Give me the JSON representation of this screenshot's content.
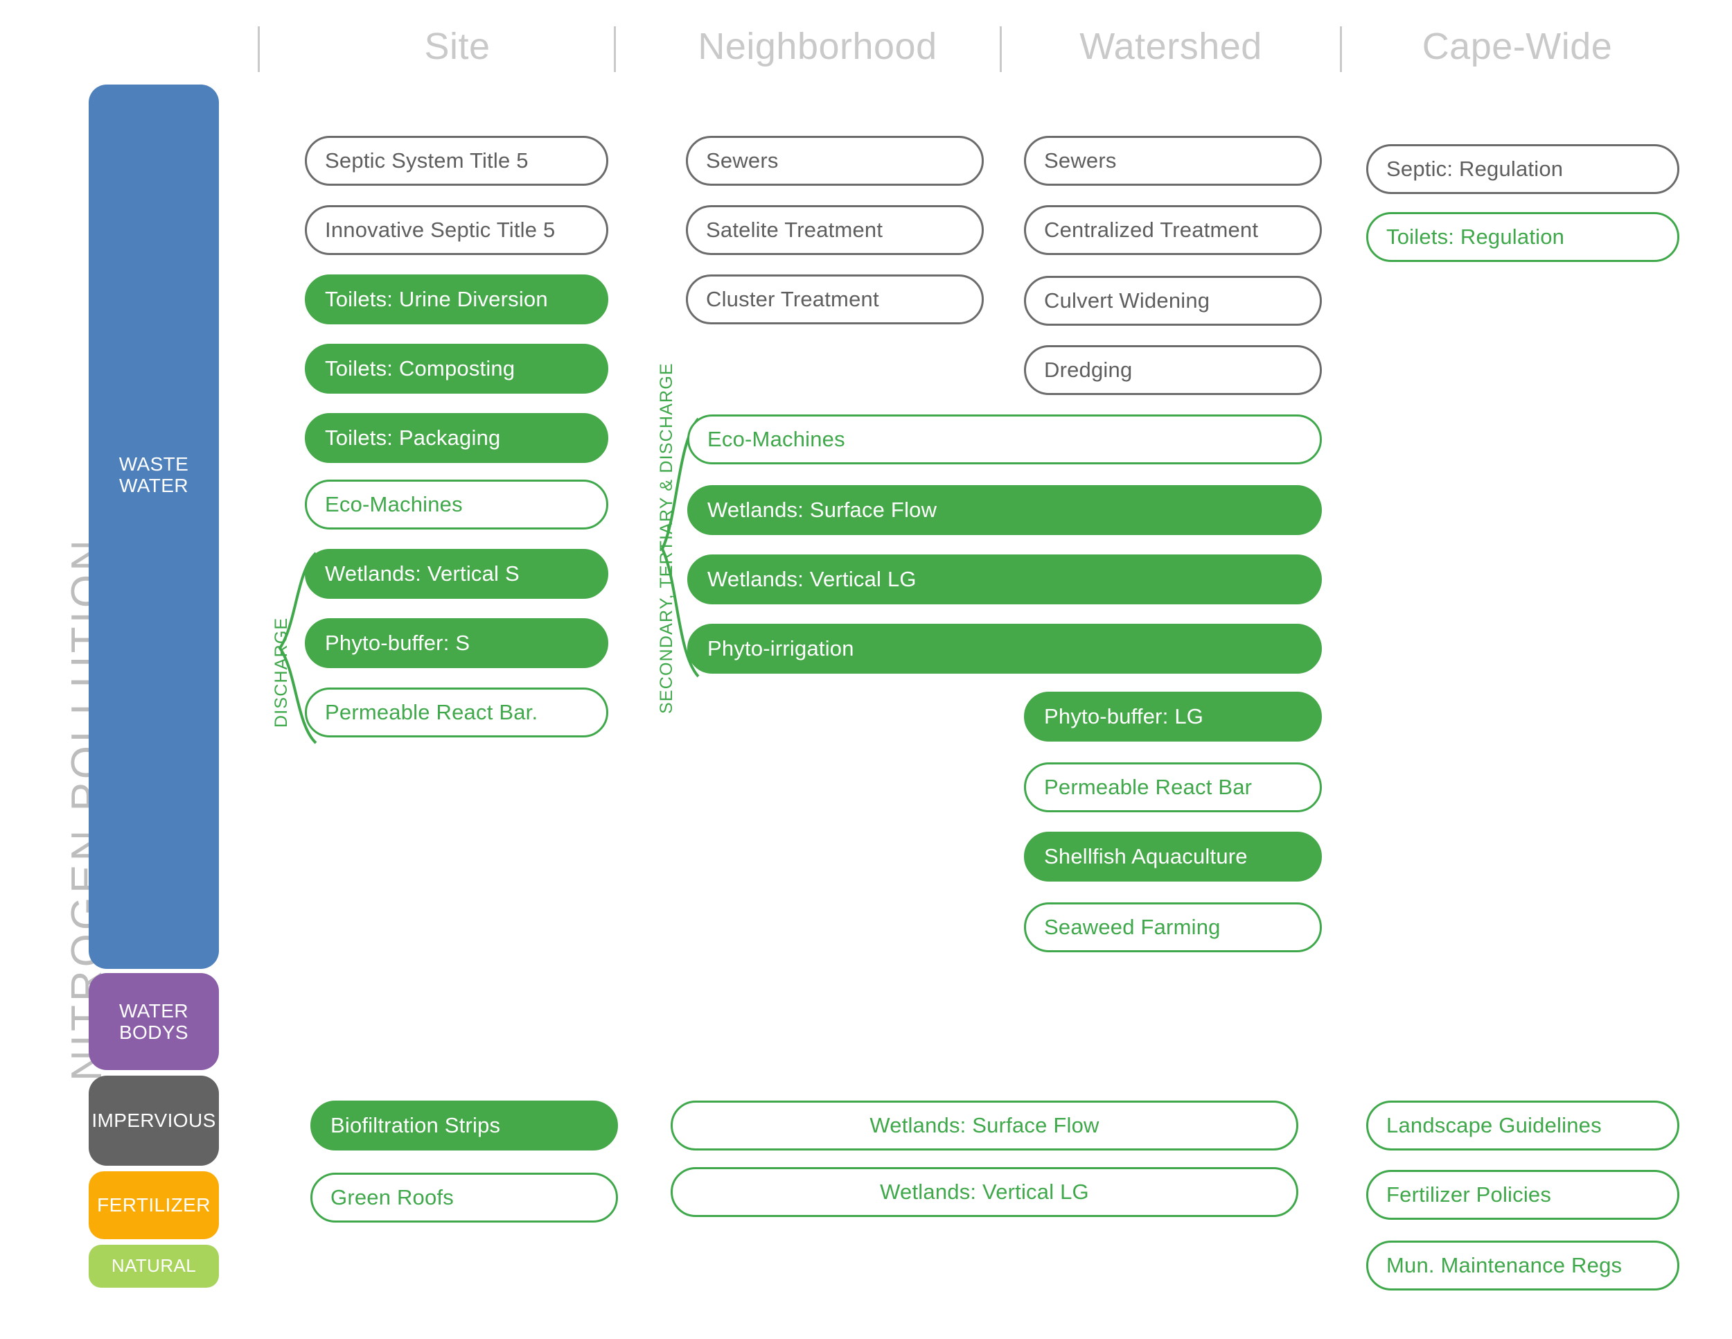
{
  "page_title": "NITROGEN  POLLUTION",
  "columns": {
    "headers": [
      {
        "label": "Site"
      },
      {
        "label": "Neighborhood"
      },
      {
        "label": "Watershed"
      },
      {
        "label": "Cape-Wide"
      }
    ]
  },
  "colors": {
    "waste_water": "#4e80bc",
    "water_bodys": "#8b5fa8",
    "impervious": "#636363",
    "fertilizer": "#fbab06",
    "natural": "#a8d45b",
    "green_fill": "#45a949",
    "green_outline": "#3fa84a",
    "gray_outline": "#6b6b6b",
    "header_gray": "#c9c9c9"
  },
  "source_bands": [
    {
      "id": "waste-water",
      "label_line1": "WASTE",
      "label_line2": "WATER"
    },
    {
      "id": "water-bodys",
      "label_line1": "WATER",
      "label_line2": "BODYS"
    },
    {
      "id": "impervious",
      "label_line1": "IMPERVIOUS",
      "label_line2": ""
    },
    {
      "id": "fertilizer",
      "label_line1": "FERTILIZER",
      "label_line2": ""
    },
    {
      "id": "natural",
      "label_line1": "NATURAL",
      "label_line2": ""
    }
  ],
  "brackets": [
    {
      "id": "discharge",
      "label": "DISCHARGE"
    },
    {
      "id": "secondary-tertiary-discharge",
      "label": "SECONDARY, TERTIARY & DISCHARGE"
    }
  ],
  "strategies": {
    "site": [
      {
        "label": "Septic System Title 5",
        "style": "outline-gray"
      },
      {
        "label": "Innovative Septic Title 5",
        "style": "outline-gray"
      },
      {
        "label": "Toilets: Urine Diversion",
        "style": "fill-green"
      },
      {
        "label": "Toilets: Composting",
        "style": "fill-green"
      },
      {
        "label": "Toilets: Packaging",
        "style": "fill-green"
      },
      {
        "label": "Eco-Machines",
        "style": "outline-green"
      },
      {
        "label": "Wetlands: Vertical S",
        "style": "fill-green"
      },
      {
        "label": "Phyto-buffer: S",
        "style": "fill-green"
      },
      {
        "label": "Permeable React Bar.",
        "style": "outline-green"
      }
    ],
    "neighborhood": [
      {
        "label": "Sewers",
        "style": "outline-gray"
      },
      {
        "label": "Satelite Treatment",
        "style": "outline-gray"
      },
      {
        "label": "Cluster Treatment",
        "style": "outline-gray"
      }
    ],
    "watershed": [
      {
        "label": "Sewers",
        "style": "outline-gray"
      },
      {
        "label": "Centralized Treatment",
        "style": "outline-gray"
      },
      {
        "label": "Culvert Widening",
        "style": "outline-gray"
      },
      {
        "label": "Dredging",
        "style": "outline-gray"
      }
    ],
    "spanning": [
      {
        "label": "Eco-Machines",
        "style": "outline-green"
      },
      {
        "label": "Wetlands: Surface Flow",
        "style": "fill-green"
      },
      {
        "label": "Wetlands: Vertical LG",
        "style": "fill-green"
      },
      {
        "label": "Phyto-irrigation",
        "style": "fill-green"
      }
    ],
    "watershed_lower": [
      {
        "label": "Phyto-buffer: LG",
        "style": "fill-green"
      },
      {
        "label": "Permeable React Bar",
        "style": "outline-green"
      },
      {
        "label": "Shellfish Aquaculture",
        "style": "fill-green"
      },
      {
        "label": "Seaweed Farming",
        "style": "outline-green"
      }
    ],
    "cape_wide": [
      {
        "label": "Septic: Regulation",
        "style": "outline-gray"
      },
      {
        "label": "Toilets: Regulation",
        "style": "outline-green"
      }
    ],
    "impervious_site": [
      {
        "label": "Biofiltration Strips",
        "style": "fill-green"
      },
      {
        "label": "Green Roofs",
        "style": "outline-green"
      }
    ],
    "impervious_span": [
      {
        "label": "Wetlands: Surface Flow",
        "style": "outline-green"
      },
      {
        "label": "Wetlands: Vertical LG",
        "style": "outline-green"
      }
    ],
    "impervious_cape": [
      {
        "label": "Landscape Guidelines",
        "style": "outline-green"
      },
      {
        "label": "Fertilizer Policies",
        "style": "outline-green"
      },
      {
        "label": "Mun. Maintenance Regs",
        "style": "outline-green"
      }
    ]
  }
}
